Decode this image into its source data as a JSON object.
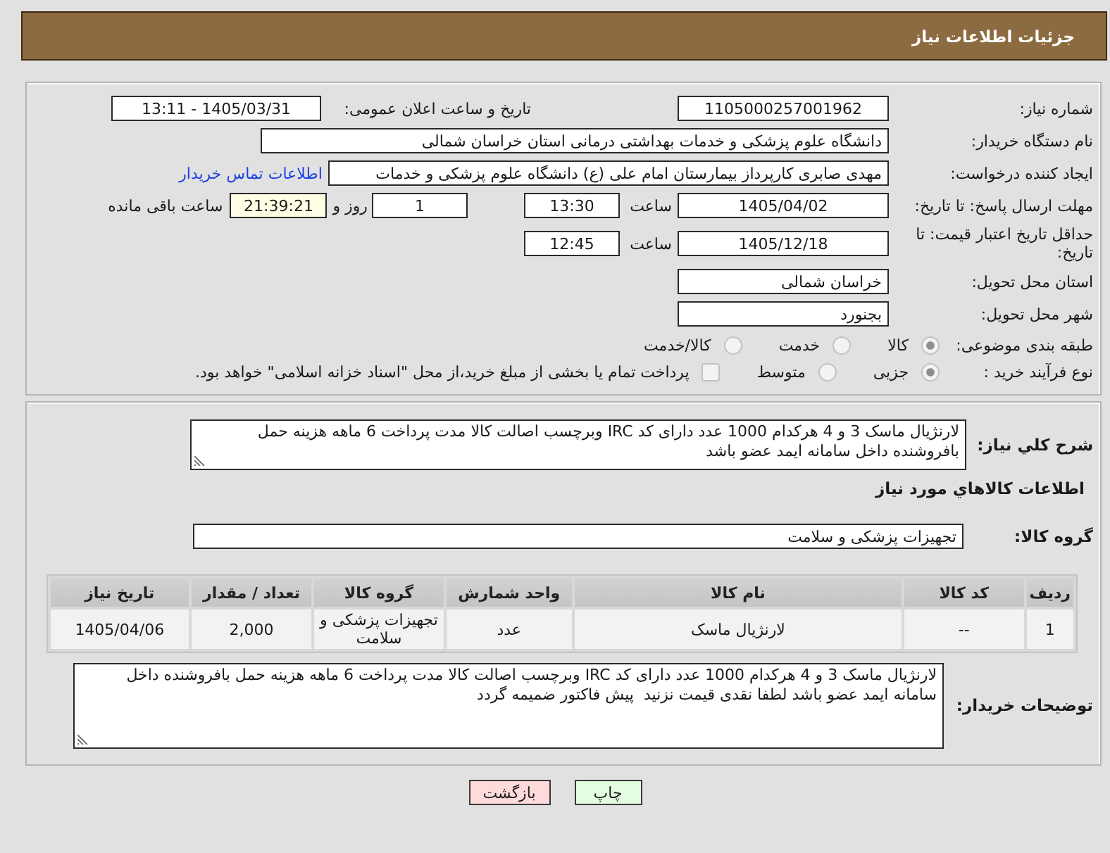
{
  "header": {
    "title": "جزئیات اطلاعات نیاز"
  },
  "need_number": {
    "label": "شماره نیاز:",
    "value": "1105000257001962"
  },
  "announce": {
    "label": "تاریخ و ساعت اعلان عمومی:",
    "value": "1405/03/31 - 13:11"
  },
  "buyer_org": {
    "label": "نام دستگاه خریدار:",
    "value": "دانشگاه علوم پزشکی و خدمات بهداشتی درمانی استان خراسان شمالی"
  },
  "requester": {
    "label": "ایجاد کننده درخواست:",
    "value": "مهدی صابری کارپرداز بیمارستان امام علی (ع) دانشگاه علوم پزشکی و خدمات",
    "link": "اطلاعات تماس خریدار"
  },
  "response_deadline": {
    "label": "مهلت ارسال پاسخ: تا تاریخ:",
    "date": "1405/04/02",
    "time_label": "ساعت",
    "time": "13:30",
    "days": "1",
    "days_label": "روز و",
    "remaining": "21:39:21",
    "remaining_label": "ساعت باقی مانده"
  },
  "price_validity": {
    "label": "حداقل تاریخ اعتبار قیمت: تا تاریخ:",
    "date": "1405/12/18",
    "time_label": "ساعت",
    "time": "12:45"
  },
  "delivery_province": {
    "label": "استان محل تحویل:",
    "value": "خراسان شمالی"
  },
  "delivery_city": {
    "label": "شهر محل تحویل:",
    "value": "بجنورد"
  },
  "category": {
    "label": "طبقه بندی موضوعی:",
    "options": [
      {
        "label": "کالا",
        "selected": true
      },
      {
        "label": "خدمت",
        "selected": false
      },
      {
        "label": "کالا/خدمت",
        "selected": false
      }
    ]
  },
  "purchase_type": {
    "label": "نوع فرآیند خرید :",
    "options": [
      {
        "label": "جزیی",
        "selected": true
      },
      {
        "label": "متوسط",
        "selected": false
      }
    ],
    "treasury_payment": {
      "label": "پرداخت تمام یا بخشی از مبلغ خرید،از محل \"اسناد خزانه اسلامی\" خواهد بود.",
      "checked": false
    }
  },
  "description": {
    "label": "شرح کلي نیاز:",
    "value": "لارنژیال ماسک 3 و 4 هرکدام 1000 عدد دارای کد IRC وبرچسب اصالت کالا مدت پرداخت 6 ماهه هزینه حمل بافروشنده داخل سامانه ایمد عضو باشد"
  },
  "goods_section": {
    "title": "اطلاعات کالاهاي مورد نیاز"
  },
  "goods_group": {
    "label": "گروه کالا:",
    "value": "تجهیزات پزشکی و سلامت"
  },
  "table": {
    "columns": [
      "ردیف",
      "کد کالا",
      "نام کالا",
      "واحد شمارش",
      "گروه کالا",
      "تعداد / مقدار",
      "تاریخ نیاز"
    ],
    "rows": [
      [
        "1",
        "--",
        "لارنژیال ماسک",
        "عدد",
        "تجهیزات پزشکی و سلامت",
        "2,000",
        "1405/04/06"
      ]
    ]
  },
  "buyer_notes": {
    "label": "توضیحات خریدار:",
    "value": "لارنژیال ماسک 3 و 4 هرکدام 1000 عدد دارای کد IRC وبرچسب اصالت کالا مدت پرداخت 6 ماهه هزینه حمل بافروشنده داخل سامانه ایمد عضو باشد لطفا نقدی قیمت نزنید  پیش فاکتور ضمیمه گردد"
  },
  "buttons": [
    {
      "label": "چاپ",
      "kind": "print"
    },
    {
      "label": "بازگشت",
      "kind": "back"
    }
  ]
}
